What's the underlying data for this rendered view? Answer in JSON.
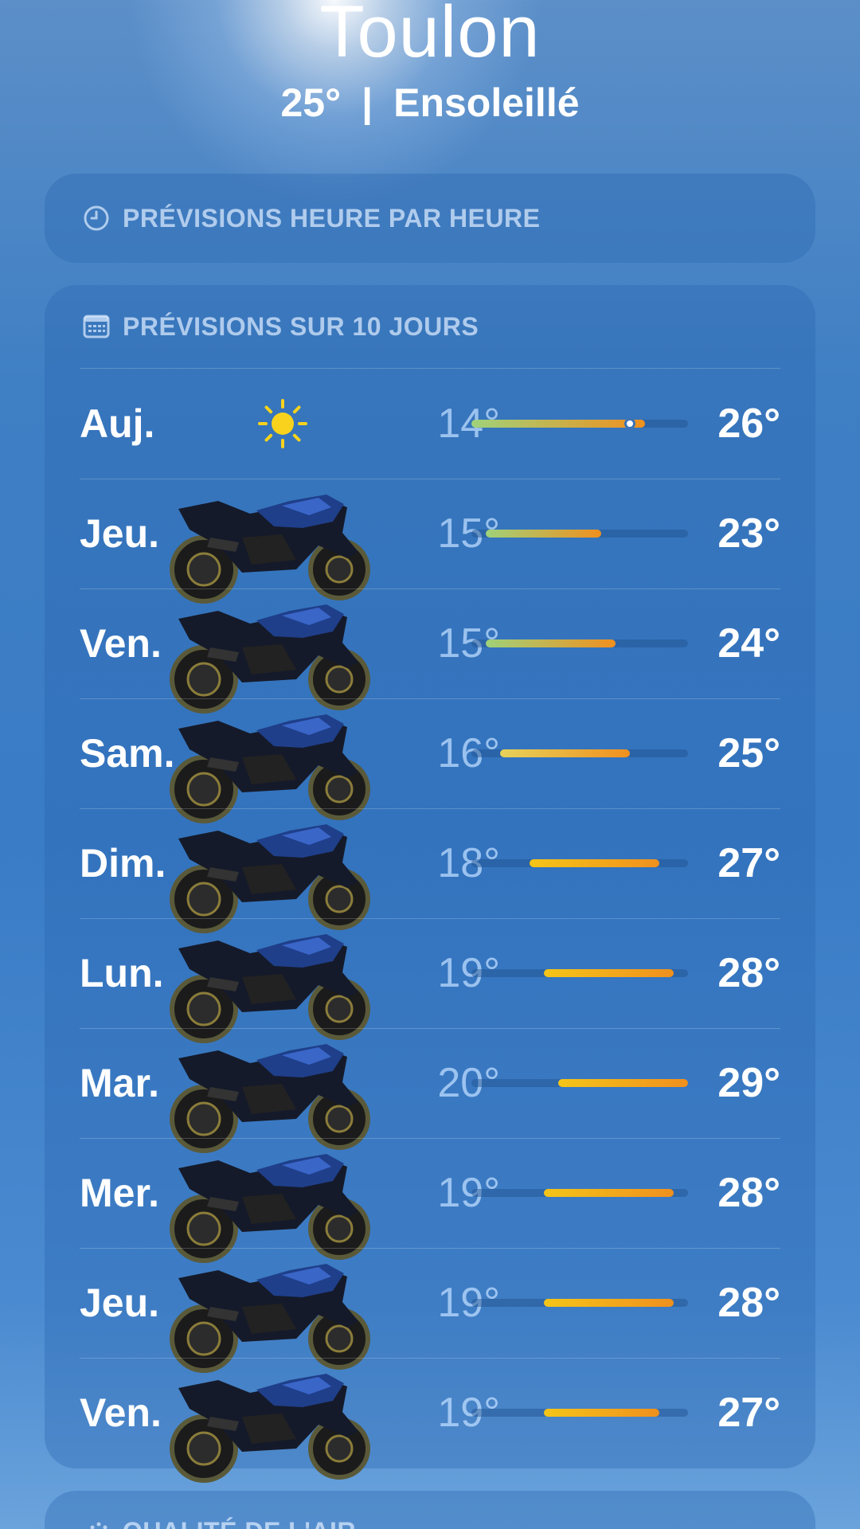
{
  "location": {
    "city": "Toulon",
    "temp": "25°",
    "separator": "|",
    "condition": "Ensoleillé"
  },
  "hourly": {
    "title": "PRÉVISIONS HEURE PAR HEURE",
    "icon": "clock-icon"
  },
  "forecast": {
    "title": "PRÉVISIONS SUR 10 JOURS",
    "icon": "calendar-icon",
    "range_min": 14,
    "range_max": 29,
    "current_temp": 25,
    "days": [
      {
        "day": "Auj.",
        "icon": "sun-icon",
        "low": "14°",
        "high": "26°",
        "low_v": 14,
        "high_v": 26
      },
      {
        "day": "Jeu.",
        "icon": "motorcycle-image",
        "low": "15°",
        "high": "23°",
        "low_v": 15,
        "high_v": 23
      },
      {
        "day": "Ven.",
        "icon": "motorcycle-image",
        "low": "15°",
        "high": "24°",
        "low_v": 15,
        "high_v": 24
      },
      {
        "day": "Sam.",
        "icon": "motorcycle-image",
        "low": "16°",
        "high": "25°",
        "low_v": 16,
        "high_v": 25
      },
      {
        "day": "Dim.",
        "icon": "motorcycle-image",
        "low": "18°",
        "high": "27°",
        "low_v": 18,
        "high_v": 27
      },
      {
        "day": "Lun.",
        "icon": "motorcycle-image",
        "low": "19°",
        "high": "28°",
        "low_v": 19,
        "high_v": 28
      },
      {
        "day": "Mar.",
        "icon": "motorcycle-image",
        "low": "20°",
        "high": "29°",
        "low_v": 20,
        "high_v": 29
      },
      {
        "day": "Mer.",
        "icon": "motorcycle-image",
        "low": "19°",
        "high": "28°",
        "low_v": 19,
        "high_v": 28
      },
      {
        "day": "Jeu.",
        "icon": "motorcycle-image",
        "low": "19°",
        "high": "28°",
        "low_v": 19,
        "high_v": 28
      },
      {
        "day": "Ven.",
        "icon": "motorcycle-image",
        "low": "19°",
        "high": "27°",
        "low_v": 19,
        "high_v": 27
      }
    ]
  },
  "air_quality": {
    "title": "QUALITÉ DE L'AIR",
    "icon": "air-quality-icon"
  },
  "colors": {
    "cool": "#9fd27a",
    "mild": "#e6d25a",
    "warm": "#f5c518",
    "hot": "#f0901e"
  }
}
